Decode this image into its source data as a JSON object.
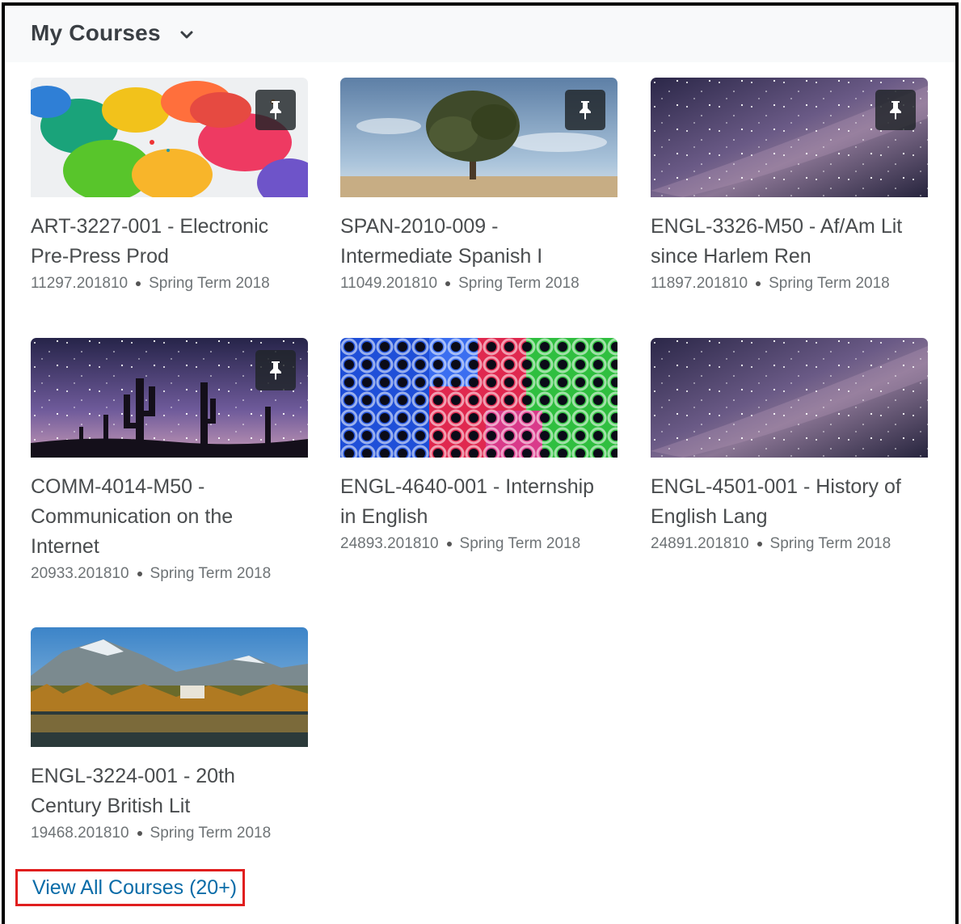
{
  "header": {
    "title": "My Courses"
  },
  "courses": [
    {
      "title": "ART-3227-001 - Electronic Pre-Press Prod",
      "code": "11297.201810",
      "term": "Spring Term 2018",
      "pinned": true
    },
    {
      "title": "SPAN-2010-009 - Intermediate Spanish I",
      "code": "11049.201810",
      "term": "Spring Term 2018",
      "pinned": true
    },
    {
      "title": "ENGL-3326-M50 - Af/Am Lit since Harlem Ren",
      "code": "11897.201810",
      "term": "Spring Term 2018",
      "pinned": true
    },
    {
      "title": "COMM-4014-M50 - Communication on the Internet",
      "code": "20933.201810",
      "term": "Spring Term 2018",
      "pinned": true
    },
    {
      "title": "ENGL-4640-001 - Internship in English",
      "code": "24893.201810",
      "term": "Spring Term 2018",
      "pinned": false
    },
    {
      "title": "ENGL-4501-001 - History of English Lang",
      "code": "24891.201810",
      "term": "Spring Term 2018",
      "pinned": false
    },
    {
      "title": "ENGL-3224-001 - 20th Century British Lit",
      "code": "19468.201810",
      "term": "Spring Term 2018",
      "pinned": false
    }
  ],
  "view_all_label": "View All Courses (20+)",
  "icons": {
    "pin": "pin-icon",
    "chevron": "chevron-down-icon"
  },
  "colors": {
    "link": "#0a6ca8",
    "highlight_box": "#e01e1e",
    "title_text": "#494c4e"
  }
}
